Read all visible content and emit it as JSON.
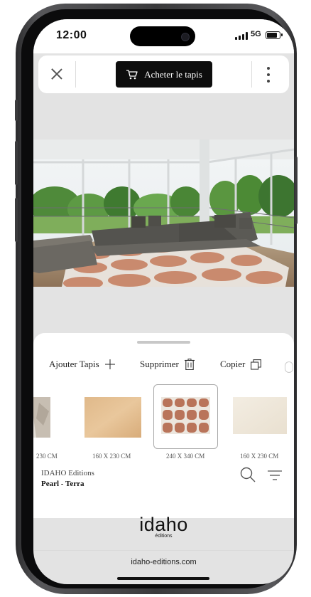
{
  "status": {
    "time": "12:00",
    "network": "5G"
  },
  "topbar": {
    "buy_label": "Acheter le tapis"
  },
  "actions": {
    "add_label": "Ajouter Tapis",
    "delete_label": "Supprimer",
    "copy_label": "Copier"
  },
  "rugs": [
    {
      "size": "230 CM"
    },
    {
      "size": "160 X 230 CM"
    },
    {
      "size": "240 X 340 CM",
      "selected": true
    },
    {
      "size": "160 X 230 CM"
    }
  ],
  "product": {
    "brand": "IDAHO Editions",
    "name": "Pearl - Terra"
  },
  "logo": {
    "main": "idaho",
    "sub": "éditions"
  },
  "footer": {
    "url": "idaho-editions.com"
  },
  "colors": {
    "button_bg": "#0d0d0d",
    "rug_terra": "#c98a6e",
    "sheet_bg": "#ffffff",
    "screen_bg": "#e3e3e3"
  }
}
